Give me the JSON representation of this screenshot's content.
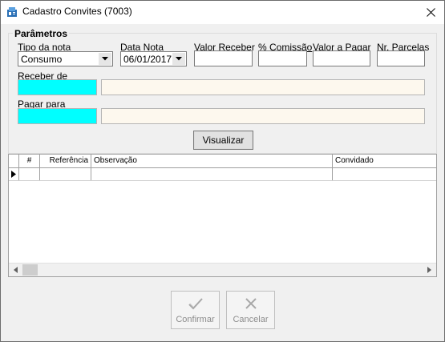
{
  "window": {
    "title": "Cadastro Convites (7003)"
  },
  "params": {
    "legend": "Parâmetros",
    "tipo_nota_label": "Tipo da nota",
    "tipo_nota_value": "Consumo",
    "data_nota_label": "Data Nota",
    "data_nota_value": "06/01/2017",
    "valor_receber_label": "Valor Receber",
    "valor_receber_value": "",
    "comissao_label": "% Comissão",
    "comissao_value": "",
    "valor_pagar_label": "Valor a Pagar",
    "valor_pagar_value": "",
    "nr_parcelas_label": "Nr. Parcelas",
    "nr_parcelas_value": "",
    "receber_de_label": "Receber de",
    "receber_de_code": "",
    "receber_de_name": "",
    "pagar_para_label": "Pagar para",
    "pagar_para_code": "",
    "pagar_para_name": "",
    "visualizar_label": "Visualizar"
  },
  "grid": {
    "columns": [
      "#",
      "Referência",
      "Observação",
      "Convidado"
    ],
    "rows": [
      {
        "num": "",
        "referencia": "",
        "observacao": "",
        "convidado": ""
      }
    ]
  },
  "actions": {
    "confirmar_label": "Confirmar",
    "cancelar_label": "Cancelar"
  },
  "colors": {
    "code_field": "#00ffff",
    "name_field": "#fdf8ee",
    "window_bg": "#f0f0f0",
    "disabled_text": "#8d8d8d"
  },
  "icons": {
    "app": "address-card-icon",
    "close": "close-icon",
    "dropdown": "chevron-down-icon",
    "row_pointer": "triangle-right-icon",
    "confirm": "checkmark-icon",
    "cancel": "x-mark-icon"
  }
}
